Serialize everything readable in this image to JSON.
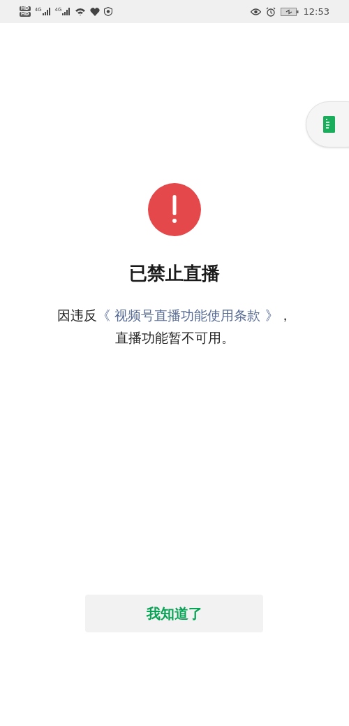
{
  "status_bar": {
    "sim_badges": [
      "HD",
      "HD"
    ],
    "network_labels": [
      "4G",
      "4G"
    ],
    "time": "12:53"
  },
  "notice": {
    "title": "已禁止直播",
    "message_before": "因违反",
    "link": "《 视频号直播功能使用条款 》",
    "message_after": "，",
    "message_line2": "直播功能暂不可用。"
  },
  "button": {
    "label": "我知道了"
  }
}
